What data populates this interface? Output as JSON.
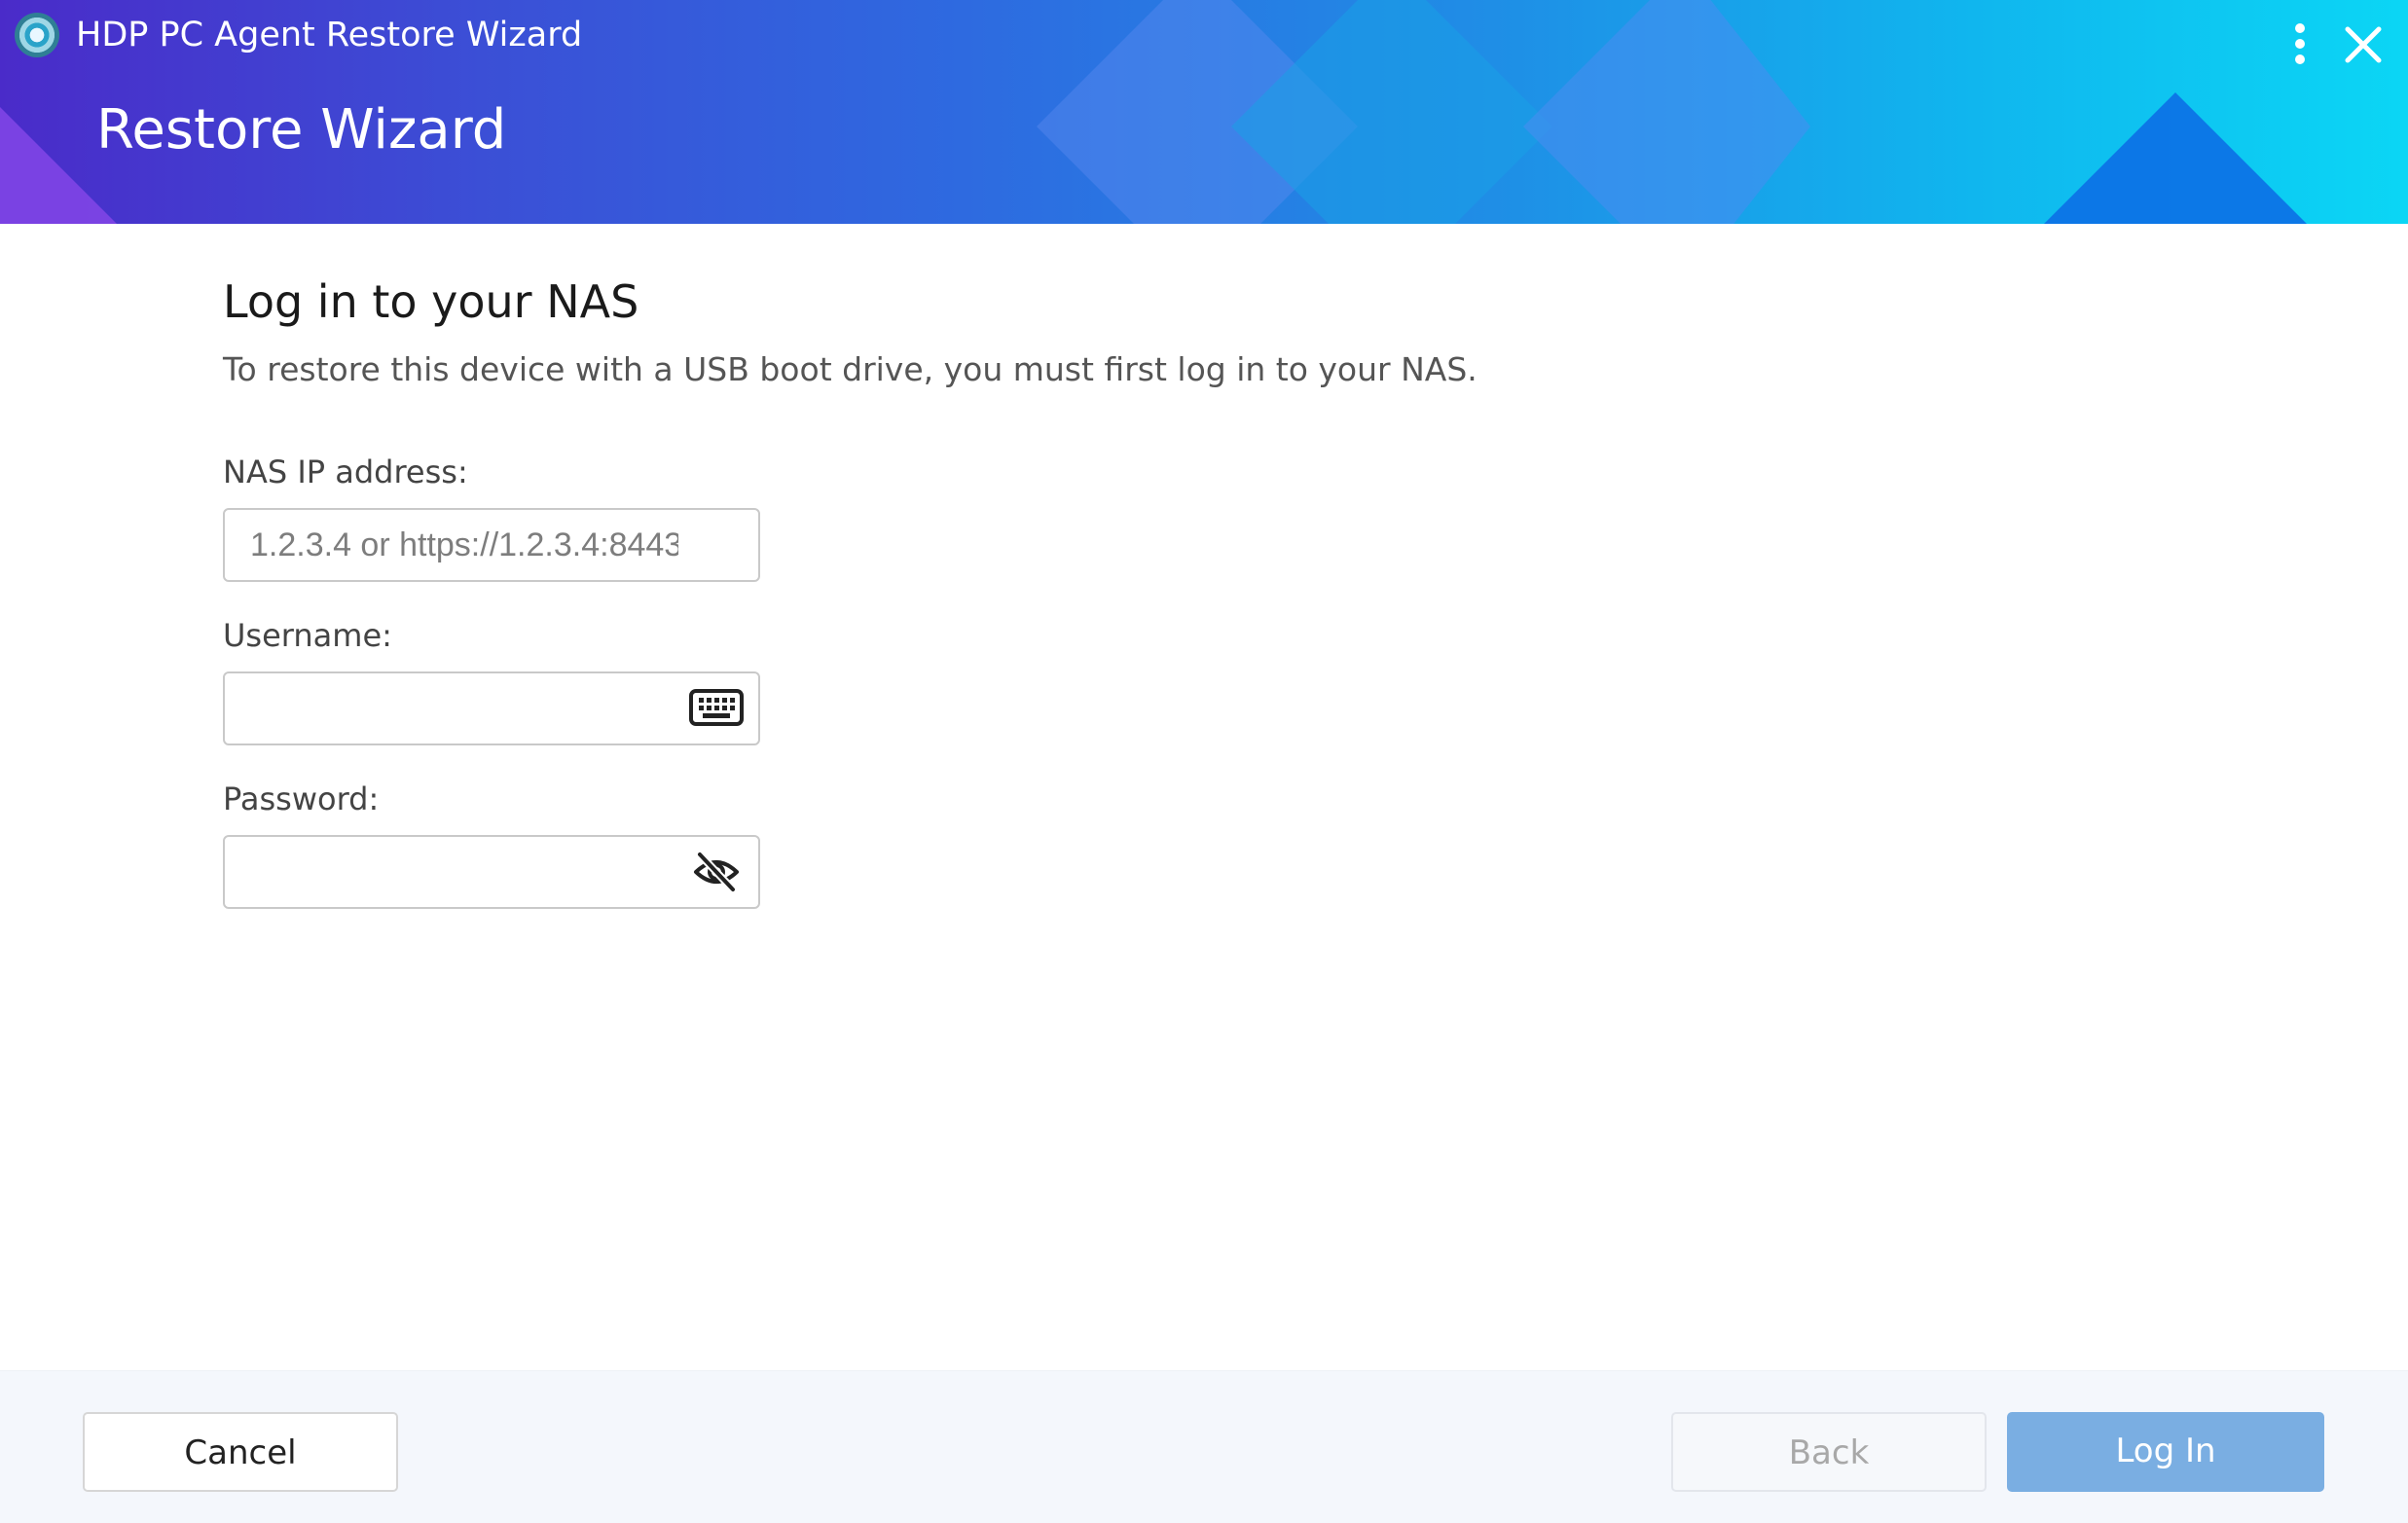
{
  "window": {
    "app_title": "HDP PC Agent Restore Wizard",
    "wizard_title": "Restore Wizard",
    "icon": "app-logo-icon",
    "more_icon": "more-vertical-icon",
    "close_icon": "close-icon"
  },
  "login": {
    "heading": "Log in to your NAS",
    "description": "To restore this device with a USB boot drive, you must first log in to your NAS.",
    "nas_ip": {
      "label": "NAS IP address:",
      "value": "",
      "placeholder": "1.2.3.4 or https://1.2.3.4:8443"
    },
    "username": {
      "label": "Username:",
      "value": "",
      "icon": "keyboard-icon"
    },
    "password": {
      "label": "Password:",
      "value": "",
      "icon": "eye-slash-icon"
    }
  },
  "footer": {
    "cancel_label": "Cancel",
    "back_label": "Back",
    "login_label": "Log In"
  },
  "colors": {
    "header_gradient_start": "#4a2bc9",
    "header_gradient_end": "#0bd6f5",
    "primary_button": "#7aaee2",
    "footer_background": "#f4f7fc"
  }
}
